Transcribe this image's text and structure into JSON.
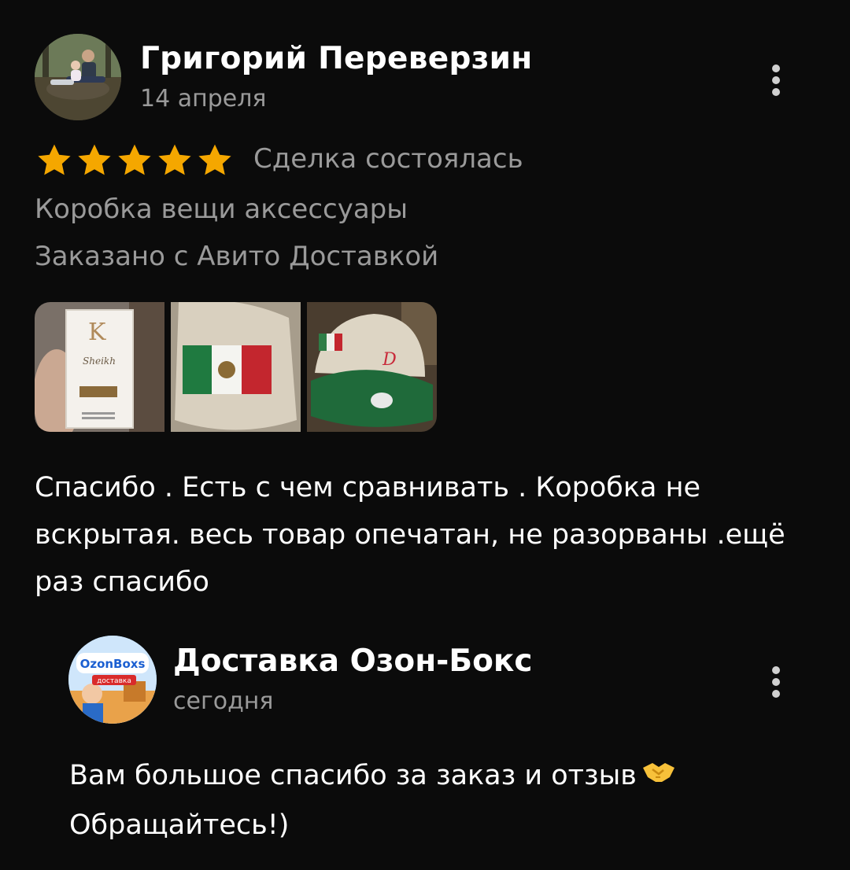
{
  "review": {
    "author": "Григорий Переверзин",
    "date": "14 апреля",
    "rating": 5,
    "star_color": "#f5a700",
    "deal_status": "Сделка состоялась",
    "item": "Коробка вещи аксессуары",
    "delivery": "Заказано с Авито Доставкой",
    "photos": [
      {
        "icon": "perfume-box-photo",
        "text": "Sheikh"
      },
      {
        "icon": "mexico-flag-patch-photo"
      },
      {
        "icon": "cap-photo"
      }
    ],
    "comment": "Спасибо . Есть с чем сравнивать . Коробка не вскрытая. весь товар опечатан, не разорваны .ещё раз спасибо"
  },
  "reply": {
    "seller": "Доставка Озон-Бокс",
    "date": "сегодня",
    "avatar_logo": "OzonBoxs",
    "avatar_caption": "доставка",
    "text_line1": "Вам большое спасибо за заказ и отзыв",
    "emoji": "handshake-icon",
    "text_line2": "Обращайтесь!)"
  },
  "colors": {
    "background": "#0b0b0b",
    "primary_text": "#ffffff",
    "secondary_text": "#9a9a9a",
    "star": "#f5a700"
  }
}
